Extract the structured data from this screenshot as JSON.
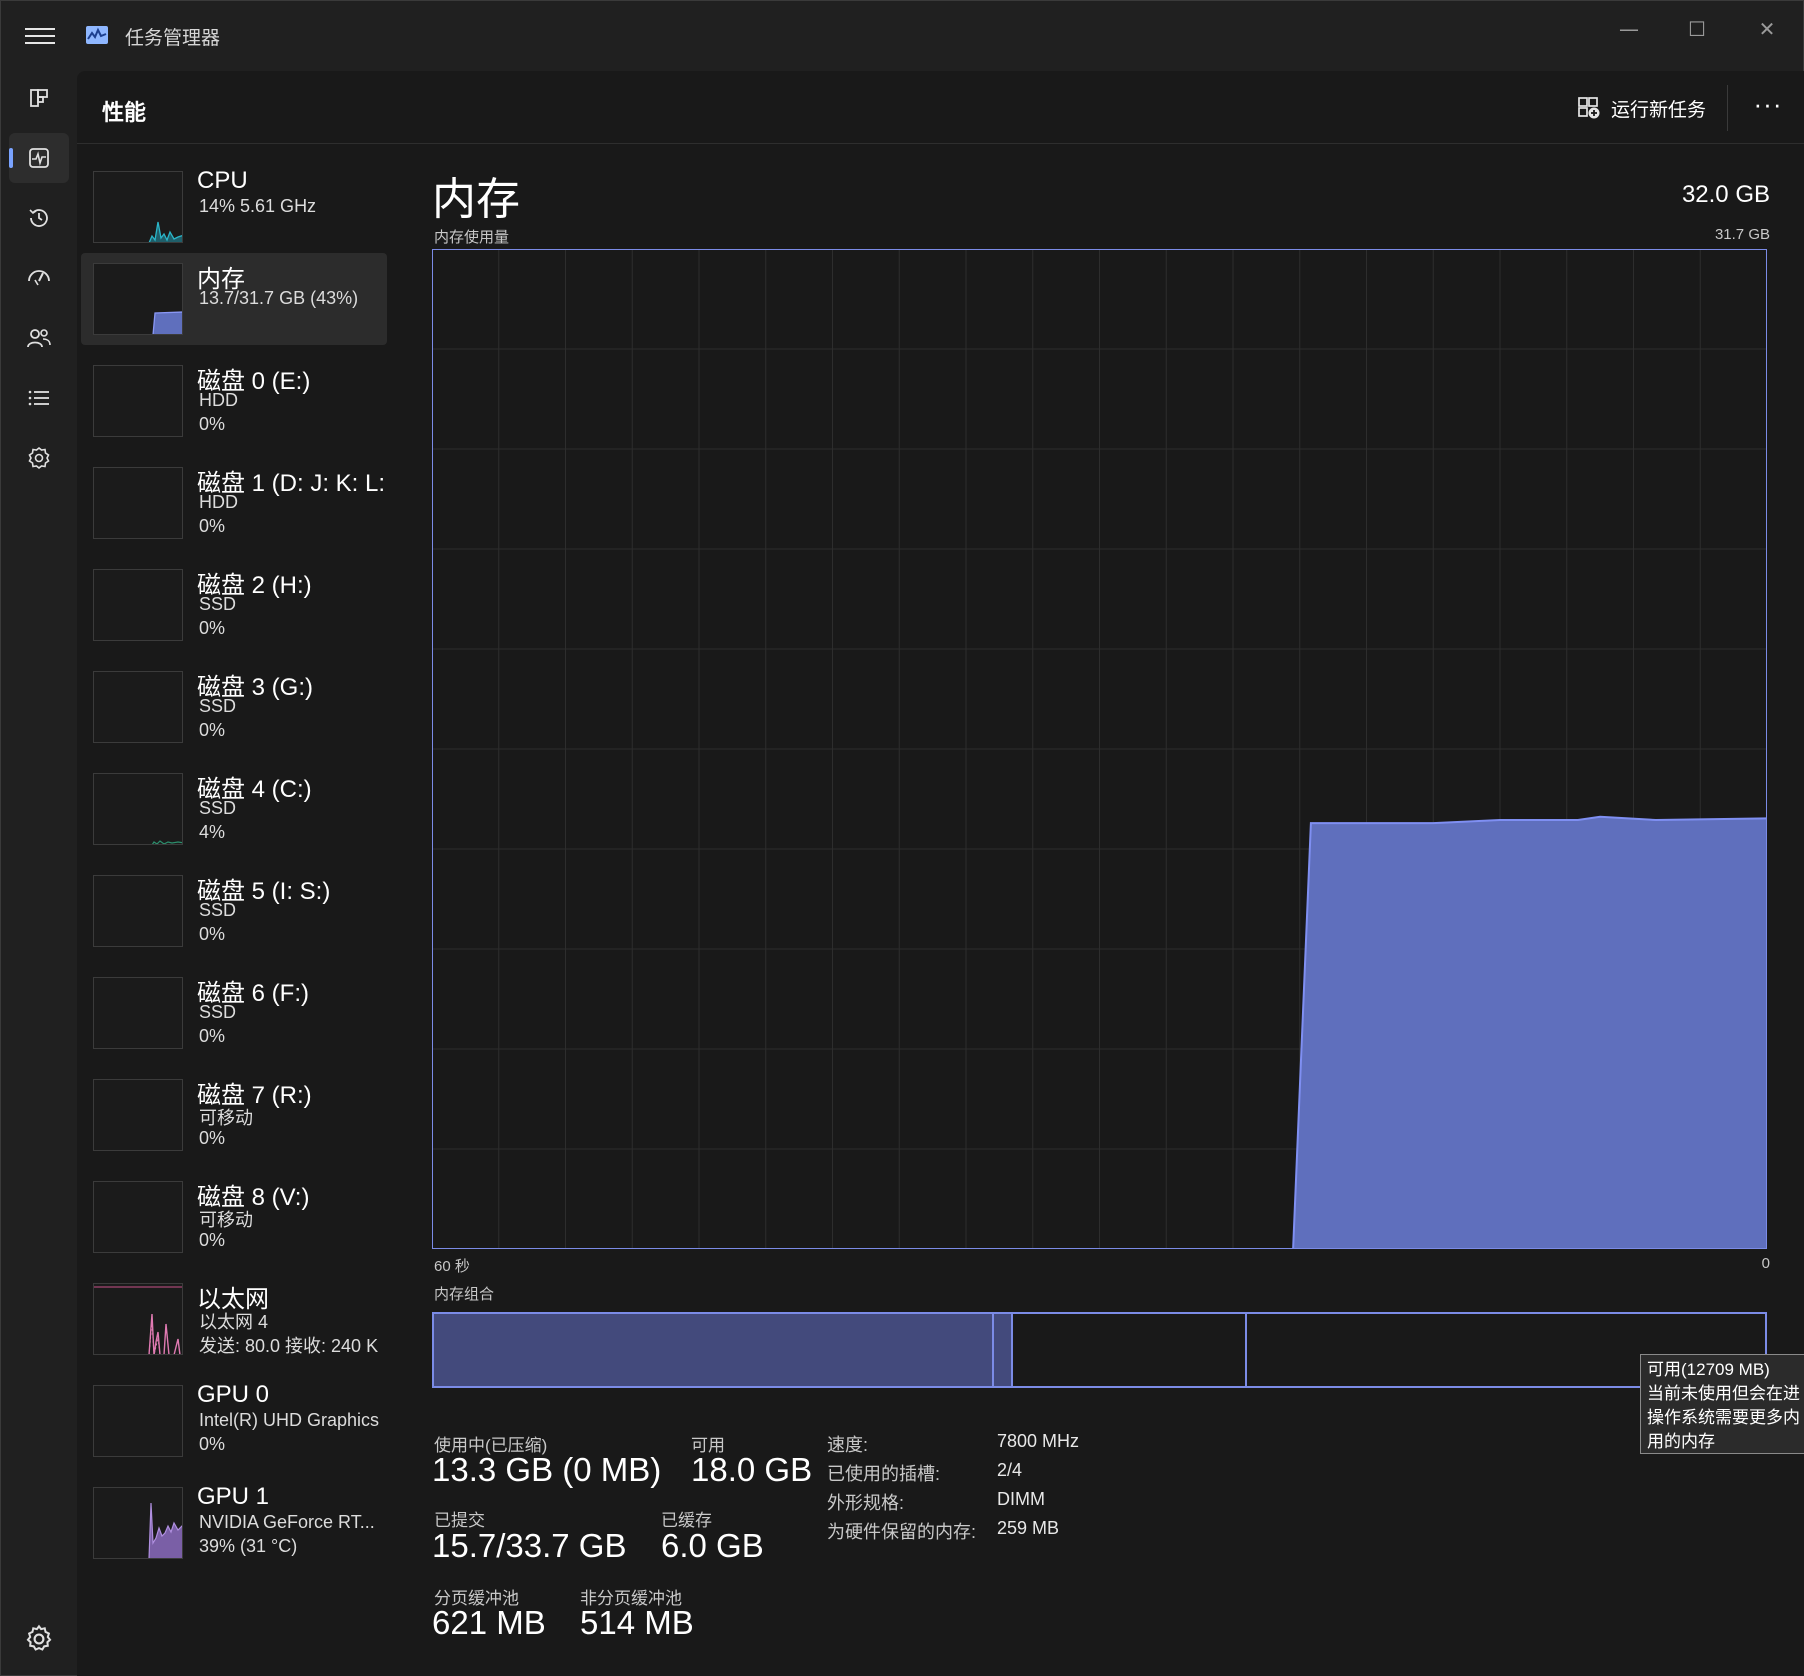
{
  "window": {
    "title": "任务管理器",
    "controls": {
      "minimize": "—",
      "maximize": "☐",
      "close": "✕"
    }
  },
  "nav": {
    "items": [
      {
        "name": "processes",
        "icon": "processes-icon"
      },
      {
        "name": "performance",
        "icon": "performance-icon",
        "active": true
      },
      {
        "name": "app-history",
        "icon": "history-icon"
      },
      {
        "name": "startup-apps",
        "icon": "startup-icon"
      },
      {
        "name": "users",
        "icon": "users-icon"
      },
      {
        "name": "details",
        "icon": "details-icon"
      },
      {
        "name": "services",
        "icon": "services-icon"
      }
    ],
    "settings_icon": "gear-icon"
  },
  "header": {
    "title": "性能",
    "run_task_label": "运行新任务",
    "more_label": "···"
  },
  "devices": [
    {
      "name": "CPU",
      "line2": "14%  5.61 GHz",
      "line3": "",
      "graph": "cpu"
    },
    {
      "name": "内存",
      "line2": "13.7/31.7 GB (43%)",
      "line3": "",
      "graph": "memory",
      "selected": true
    },
    {
      "name": "磁盘 0 (E:)",
      "line2": "HDD",
      "line3": "0%",
      "graph": "disk"
    },
    {
      "name": "磁盘 1 (D: J: K: L:",
      "line2": "HDD",
      "line3": "0%",
      "graph": "disk"
    },
    {
      "name": "磁盘 2 (H:)",
      "line2": "SSD",
      "line3": "0%",
      "graph": "disk"
    },
    {
      "name": "磁盘 3 (G:)",
      "line2": "SSD",
      "line3": "0%",
      "graph": "disk"
    },
    {
      "name": "磁盘 4 (C:)",
      "line2": "SSD",
      "line3": "4%",
      "graph": "disk-active"
    },
    {
      "name": "磁盘 5 (I: S:)",
      "line2": "SSD",
      "line3": "0%",
      "graph": "disk"
    },
    {
      "name": "磁盘 6 (F:)",
      "line2": "SSD",
      "line3": "0%",
      "graph": "disk"
    },
    {
      "name": "磁盘 7 (R:)",
      "line2": "可移动",
      "line3": "0%",
      "graph": "disk"
    },
    {
      "name": "磁盘 8 (V:)",
      "line2": "可移动",
      "line3": "0%",
      "graph": "disk"
    },
    {
      "name": "以太网",
      "line2": "以太网 4",
      "line3": "发送: 80.0  接收: 240 K",
      "graph": "ethernet"
    },
    {
      "name": "GPU 0",
      "line2": "Intel(R) UHD Graphics",
      "line3": "0%",
      "graph": "gpu0"
    },
    {
      "name": "GPU 1",
      "line2": "NVIDIA GeForce RT...",
      "line3": "39%  (31 °C)",
      "graph": "gpu1"
    }
  ],
  "memory": {
    "title": "内存",
    "total": "32.0 GB",
    "usage_label": "内存使用量",
    "usage_max": "31.7 GB",
    "axis_left": "60 秒",
    "axis_right": "0",
    "composition_label": "内存组合",
    "composition": {
      "in_use_fraction": 0.421,
      "modified_fraction": 0.014,
      "standby_fraction": 0.176,
      "free_fraction": 0.389
    },
    "tooltip_lines": [
      "可用(12709 MB)",
      "当前未使用但会在进",
      "操作系统需要更多内",
      "用的内存"
    ],
    "stats": {
      "in_use_label": "使用中(已压缩)",
      "in_use_value": "13.3 GB (0 MB)",
      "available_label": "可用",
      "available_value": "18.0 GB",
      "committed_label": "已提交",
      "committed_value": "15.7/33.7 GB",
      "cached_label": "已缓存",
      "cached_value": "6.0 GB",
      "paged_label": "分页缓冲池",
      "paged_value": "621 MB",
      "nonpaged_label": "非分页缓冲池",
      "nonpaged_value": "514 MB"
    },
    "specs": [
      {
        "key": "速度:",
        "value": "7800 MHz"
      },
      {
        "key": "已使用的插槽:",
        "value": "2/4"
      },
      {
        "key": "外形规格:",
        "value": "DIMM"
      },
      {
        "key": "为硬件保留的内存:",
        "value": "259 MB"
      }
    ]
  },
  "chart_data": {
    "type": "area",
    "title": "内存使用量",
    "x_label_left": "60 秒",
    "x_label_right": "0",
    "y_max_label": "31.7 GB",
    "xlim": [
      60,
      0
    ],
    "ylim": [
      0,
      31.7
    ],
    "grid": true,
    "series": [
      {
        "x": [
          60,
          21.3,
          20.5,
          17.5,
          15,
          12,
          10,
          8.5,
          7.5,
          5,
          0
        ],
        "values": [
          0,
          0,
          13.5,
          13.5,
          13.5,
          13.6,
          13.6,
          13.6,
          13.7,
          13.6,
          13.65
        ]
      }
    ],
    "colors": {
      "fill": "#5f6fbd",
      "line": "#7f8ff2",
      "grid": "#2d2d2d"
    }
  }
}
